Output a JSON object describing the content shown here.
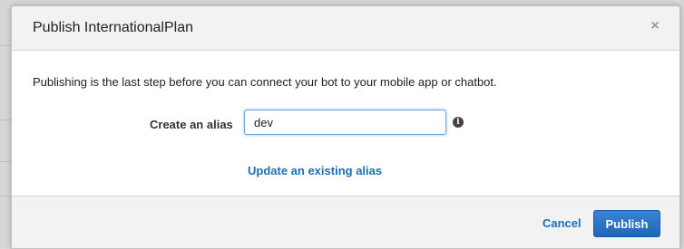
{
  "dialog": {
    "title": "Publish InternationalPlan",
    "close_glyph": "×"
  },
  "body": {
    "description": "Publishing is the last step before you can connect your bot to your mobile app or chatbot.",
    "alias_label": "Create an alias",
    "alias_value": "dev",
    "info_glyph": "i",
    "update_link": "Update an existing alias"
  },
  "footer": {
    "cancel_label": "Cancel",
    "publish_label": "Publish"
  },
  "icons": {
    "close": "close-icon",
    "info": "info-icon"
  },
  "colors": {
    "link": "#1a6fb7",
    "primary_button": "#2a74c4",
    "header_bg": "#f2f2f2"
  }
}
